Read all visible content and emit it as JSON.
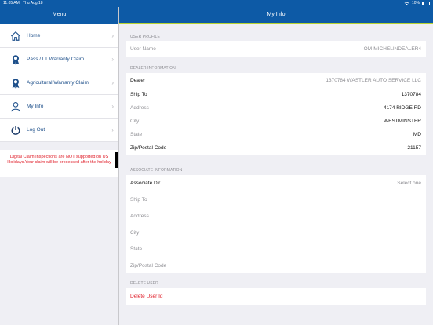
{
  "status_bar": {
    "time": "11:05 AM",
    "date": "Thu Aug 18",
    "battery": "10%",
    "battery_level": 0.1
  },
  "left_header": {
    "title": "Menu"
  },
  "right_header": {
    "title": "My Info"
  },
  "menu": {
    "items": [
      {
        "label": "Home",
        "icon": "home-icon"
      },
      {
        "label": "Pass / LT Warranty Claim",
        "icon": "award-ribbon-icon"
      },
      {
        "label": "Agricultural Warranty Claim",
        "icon": "award-ribbon-icon"
      },
      {
        "label": "My Info",
        "icon": "person-icon"
      },
      {
        "label": "Log Out",
        "icon": "power-icon"
      }
    ]
  },
  "notice": {
    "text": "Digital Claim Inspections are NOT supported on US Holidays.Your claim will be processed after the holiday"
  },
  "user_profile": {
    "section": "USER PROFILE",
    "user_name_label": "User Name",
    "user_name_value": "OM-MICHELINDEALER4"
  },
  "dealer_information": {
    "section": "DEALER INFORMATION",
    "rows": [
      {
        "label": "Dealer",
        "value": "1370784 WASTLER AUTO SERVICE  LLC"
      },
      {
        "label": "Ship To",
        "value": "1370784"
      },
      {
        "label": "Address",
        "value": "4174 RIDGE RD"
      },
      {
        "label": "City",
        "value": "WESTMINSTER"
      },
      {
        "label": "State",
        "value": "MD"
      },
      {
        "label": "Zip/Postal Code",
        "value": "21157"
      }
    ]
  },
  "associate_information": {
    "section": "ASSOCIATE INFORMATION",
    "rows": [
      {
        "label": "Associate Dlr",
        "value": "Select one"
      },
      {
        "label": "Ship To",
        "value": ""
      },
      {
        "label": "Address",
        "value": ""
      },
      {
        "label": "City",
        "value": ""
      },
      {
        "label": "State",
        "value": ""
      },
      {
        "label": "Zip/Postal Code",
        "value": ""
      }
    ]
  },
  "delete_user": {
    "section": "DELETE USER",
    "button_label": "Delete User Id"
  },
  "colors": {
    "brand_blue": "#0d5aa6",
    "accent_green": "#b7d331",
    "alert_red": "#e0202b"
  }
}
